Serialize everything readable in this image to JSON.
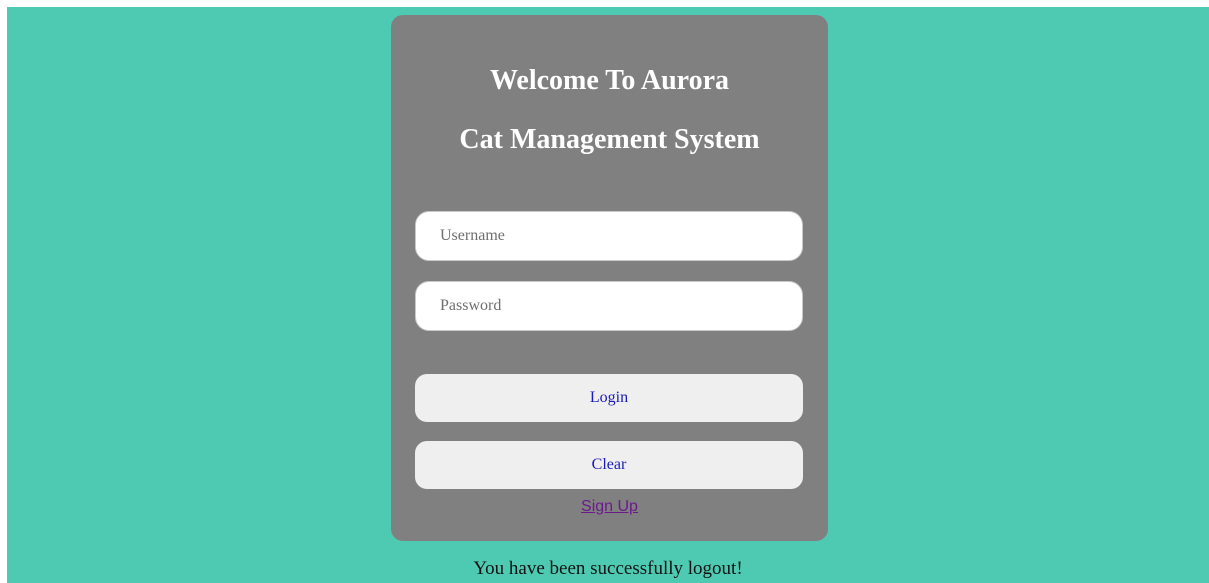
{
  "card": {
    "title_line1": "Welcome To Aurora",
    "title_line2": "Cat Management System",
    "username_placeholder": "Username",
    "password_placeholder": "Password",
    "login_label": "Login",
    "clear_label": "Clear",
    "signup_label": "Sign Up"
  },
  "status_message": "You have been successfully logout!",
  "colors": {
    "background": "#4ecab2",
    "card": "#808080",
    "button": "#efefef",
    "button_text": "#1b1bb8",
    "link": "#6b1a8c"
  }
}
